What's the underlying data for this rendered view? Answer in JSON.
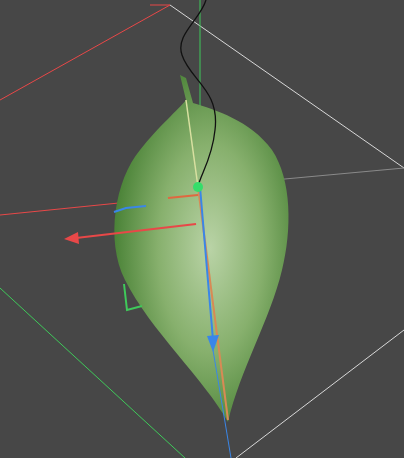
{
  "viewport": {
    "object": "leaf"
  },
  "gizmo": {
    "axes": [
      {
        "color": "#e84848"
      },
      {
        "color": "#3fc95a"
      },
      {
        "color": "#3a86e8"
      }
    ]
  }
}
